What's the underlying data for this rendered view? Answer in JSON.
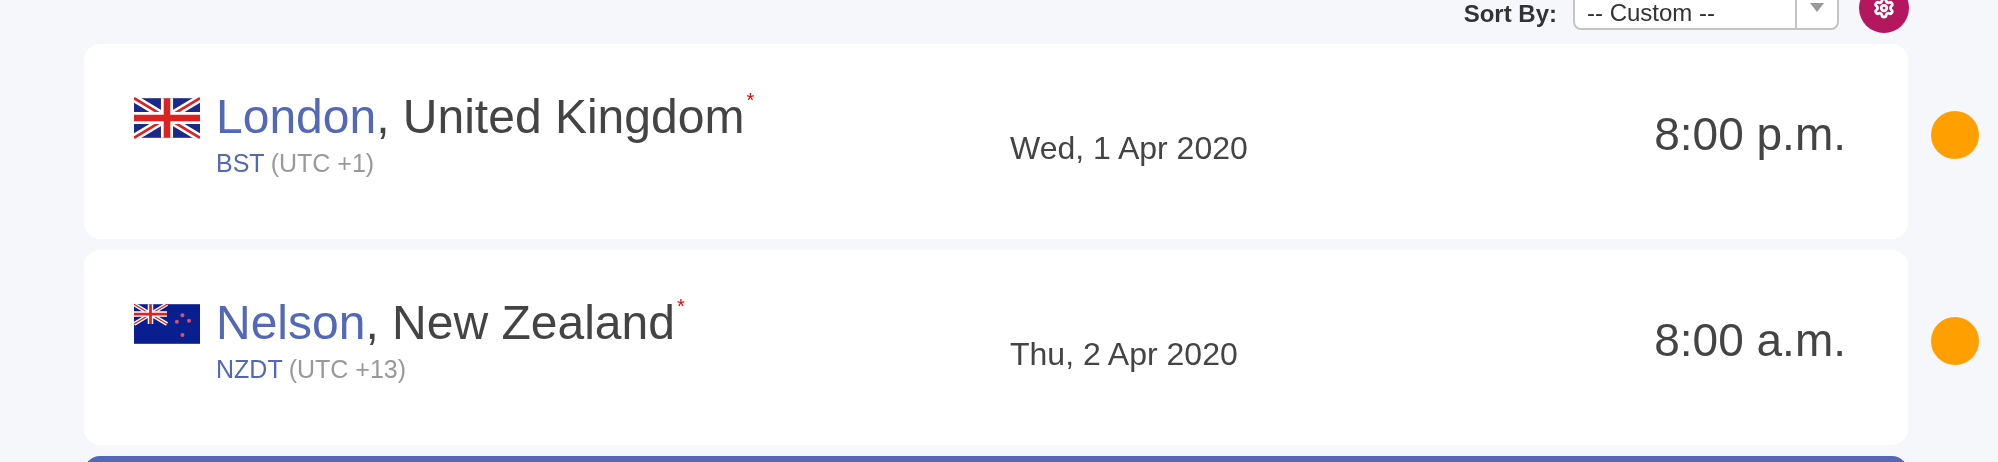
{
  "sort": {
    "label": "Sort By:",
    "value": "-- Custom --"
  },
  "locations": [
    {
      "kind": "gb",
      "city": "London",
      "country": ", United Kingdom",
      "mark": "*",
      "zone": "BST",
      "offset": "(UTC +1)",
      "date": "Wed, 1 Apr 2020",
      "time": "8:00 p.m."
    },
    {
      "kind": "nz",
      "city": "Nelson",
      "country": ", New Zealand",
      "mark": "*",
      "zone": "NZDT",
      "offset": "(UTC +13)",
      "date": "Thu, 2 Apr 2020",
      "time": "8:00 a.m."
    }
  ]
}
